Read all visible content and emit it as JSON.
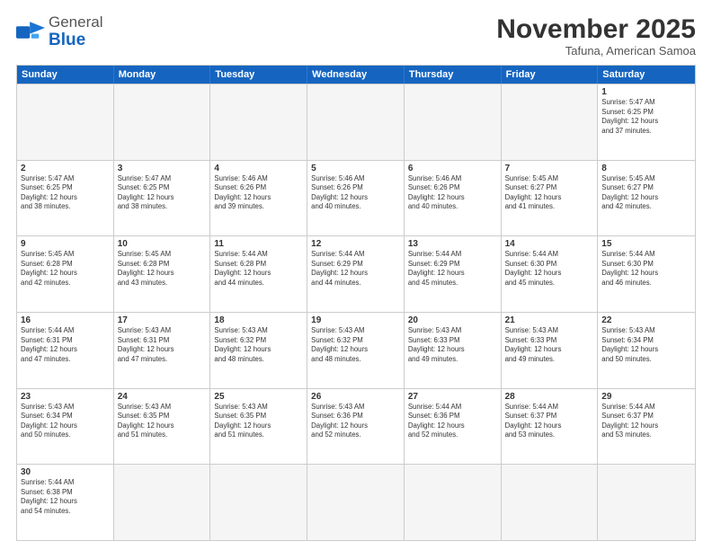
{
  "header": {
    "logo_general": "General",
    "logo_blue": "Blue",
    "month_title": "November 2025",
    "subtitle": "Tafuna, American Samoa"
  },
  "weekdays": [
    "Sunday",
    "Monday",
    "Tuesday",
    "Wednesday",
    "Thursday",
    "Friday",
    "Saturday"
  ],
  "rows": [
    [
      {
        "day": "",
        "info": "",
        "empty": true
      },
      {
        "day": "",
        "info": "",
        "empty": true
      },
      {
        "day": "",
        "info": "",
        "empty": true
      },
      {
        "day": "",
        "info": "",
        "empty": true
      },
      {
        "day": "",
        "info": "",
        "empty": true
      },
      {
        "day": "",
        "info": "",
        "empty": true
      },
      {
        "day": "1",
        "info": "Sunrise: 5:47 AM\nSunset: 6:25 PM\nDaylight: 12 hours\nand 37 minutes.",
        "empty": false
      }
    ],
    [
      {
        "day": "2",
        "info": "Sunrise: 5:47 AM\nSunset: 6:25 PM\nDaylight: 12 hours\nand 38 minutes.",
        "empty": false
      },
      {
        "day": "3",
        "info": "Sunrise: 5:47 AM\nSunset: 6:25 PM\nDaylight: 12 hours\nand 38 minutes.",
        "empty": false
      },
      {
        "day": "4",
        "info": "Sunrise: 5:46 AM\nSunset: 6:26 PM\nDaylight: 12 hours\nand 39 minutes.",
        "empty": false
      },
      {
        "day": "5",
        "info": "Sunrise: 5:46 AM\nSunset: 6:26 PM\nDaylight: 12 hours\nand 40 minutes.",
        "empty": false
      },
      {
        "day": "6",
        "info": "Sunrise: 5:46 AM\nSunset: 6:26 PM\nDaylight: 12 hours\nand 40 minutes.",
        "empty": false
      },
      {
        "day": "7",
        "info": "Sunrise: 5:45 AM\nSunset: 6:27 PM\nDaylight: 12 hours\nand 41 minutes.",
        "empty": false
      },
      {
        "day": "8",
        "info": "Sunrise: 5:45 AM\nSunset: 6:27 PM\nDaylight: 12 hours\nand 42 minutes.",
        "empty": false
      }
    ],
    [
      {
        "day": "9",
        "info": "Sunrise: 5:45 AM\nSunset: 6:28 PM\nDaylight: 12 hours\nand 42 minutes.",
        "empty": false
      },
      {
        "day": "10",
        "info": "Sunrise: 5:45 AM\nSunset: 6:28 PM\nDaylight: 12 hours\nand 43 minutes.",
        "empty": false
      },
      {
        "day": "11",
        "info": "Sunrise: 5:44 AM\nSunset: 6:28 PM\nDaylight: 12 hours\nand 44 minutes.",
        "empty": false
      },
      {
        "day": "12",
        "info": "Sunrise: 5:44 AM\nSunset: 6:29 PM\nDaylight: 12 hours\nand 44 minutes.",
        "empty": false
      },
      {
        "day": "13",
        "info": "Sunrise: 5:44 AM\nSunset: 6:29 PM\nDaylight: 12 hours\nand 45 minutes.",
        "empty": false
      },
      {
        "day": "14",
        "info": "Sunrise: 5:44 AM\nSunset: 6:30 PM\nDaylight: 12 hours\nand 45 minutes.",
        "empty": false
      },
      {
        "day": "15",
        "info": "Sunrise: 5:44 AM\nSunset: 6:30 PM\nDaylight: 12 hours\nand 46 minutes.",
        "empty": false
      }
    ],
    [
      {
        "day": "16",
        "info": "Sunrise: 5:44 AM\nSunset: 6:31 PM\nDaylight: 12 hours\nand 47 minutes.",
        "empty": false
      },
      {
        "day": "17",
        "info": "Sunrise: 5:43 AM\nSunset: 6:31 PM\nDaylight: 12 hours\nand 47 minutes.",
        "empty": false
      },
      {
        "day": "18",
        "info": "Sunrise: 5:43 AM\nSunset: 6:32 PM\nDaylight: 12 hours\nand 48 minutes.",
        "empty": false
      },
      {
        "day": "19",
        "info": "Sunrise: 5:43 AM\nSunset: 6:32 PM\nDaylight: 12 hours\nand 48 minutes.",
        "empty": false
      },
      {
        "day": "20",
        "info": "Sunrise: 5:43 AM\nSunset: 6:33 PM\nDaylight: 12 hours\nand 49 minutes.",
        "empty": false
      },
      {
        "day": "21",
        "info": "Sunrise: 5:43 AM\nSunset: 6:33 PM\nDaylight: 12 hours\nand 49 minutes.",
        "empty": false
      },
      {
        "day": "22",
        "info": "Sunrise: 5:43 AM\nSunset: 6:34 PM\nDaylight: 12 hours\nand 50 minutes.",
        "empty": false
      }
    ],
    [
      {
        "day": "23",
        "info": "Sunrise: 5:43 AM\nSunset: 6:34 PM\nDaylight: 12 hours\nand 50 minutes.",
        "empty": false
      },
      {
        "day": "24",
        "info": "Sunrise: 5:43 AM\nSunset: 6:35 PM\nDaylight: 12 hours\nand 51 minutes.",
        "empty": false
      },
      {
        "day": "25",
        "info": "Sunrise: 5:43 AM\nSunset: 6:35 PM\nDaylight: 12 hours\nand 51 minutes.",
        "empty": false
      },
      {
        "day": "26",
        "info": "Sunrise: 5:43 AM\nSunset: 6:36 PM\nDaylight: 12 hours\nand 52 minutes.",
        "empty": false
      },
      {
        "day": "27",
        "info": "Sunrise: 5:44 AM\nSunset: 6:36 PM\nDaylight: 12 hours\nand 52 minutes.",
        "empty": false
      },
      {
        "day": "28",
        "info": "Sunrise: 5:44 AM\nSunset: 6:37 PM\nDaylight: 12 hours\nand 53 minutes.",
        "empty": false
      },
      {
        "day": "29",
        "info": "Sunrise: 5:44 AM\nSunset: 6:37 PM\nDaylight: 12 hours\nand 53 minutes.",
        "empty": false
      }
    ],
    [
      {
        "day": "30",
        "info": "Sunrise: 5:44 AM\nSunset: 6:38 PM\nDaylight: 12 hours\nand 54 minutes.",
        "empty": false
      },
      {
        "day": "",
        "info": "",
        "empty": true
      },
      {
        "day": "",
        "info": "",
        "empty": true
      },
      {
        "day": "",
        "info": "",
        "empty": true
      },
      {
        "day": "",
        "info": "",
        "empty": true
      },
      {
        "day": "",
        "info": "",
        "empty": true
      },
      {
        "day": "",
        "info": "",
        "empty": true
      }
    ]
  ]
}
